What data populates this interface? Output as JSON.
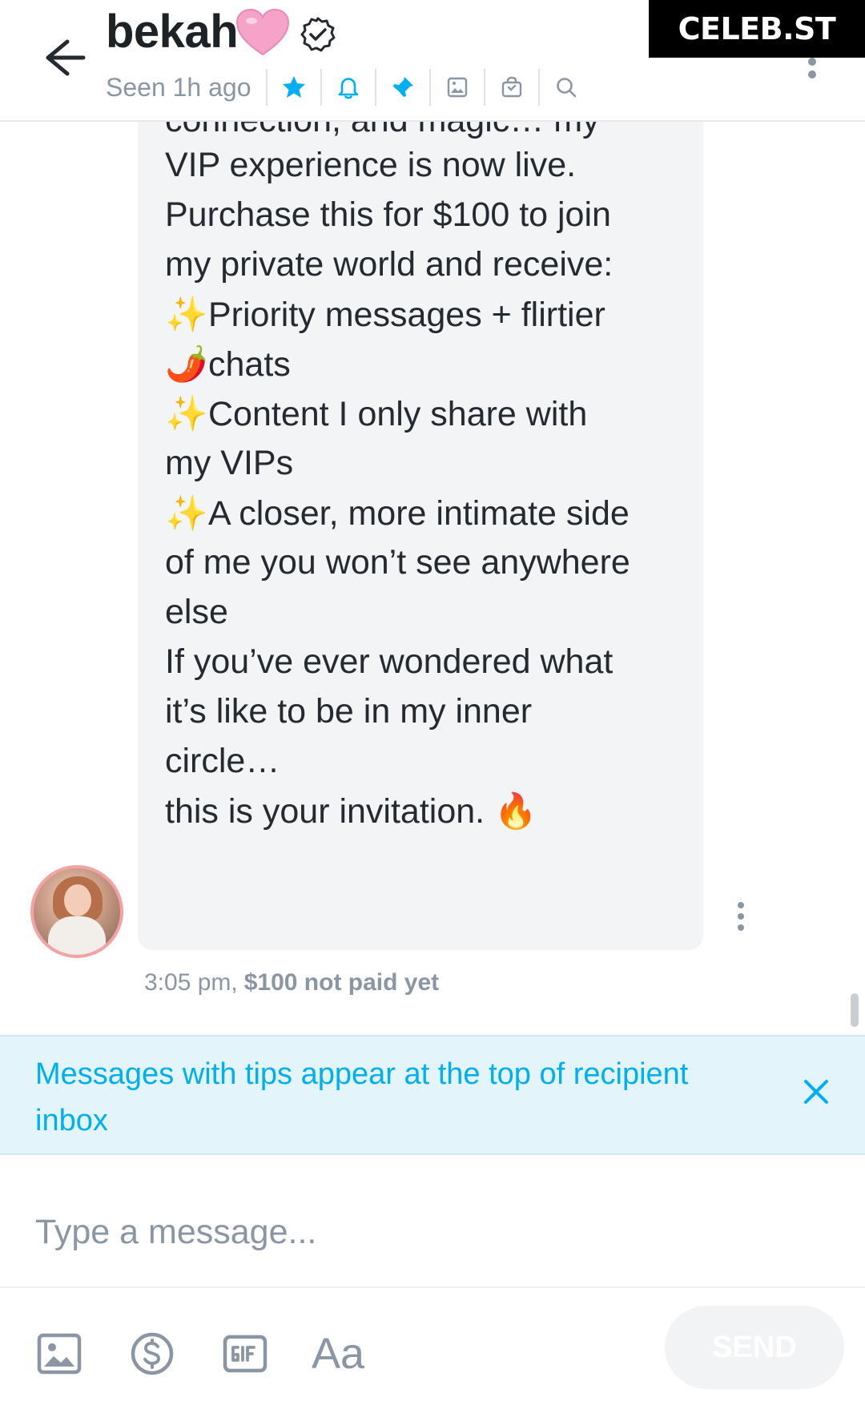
{
  "header": {
    "name": "bekah",
    "heart_emoji": "🩷",
    "seen": "Seen 1h ago"
  },
  "brand": "CELEB.ST",
  "message": {
    "lines": [
      "connection, and magic… my",
      "VIP experience is now live.",
      "Purchase this for $100 to join",
      "my private world and receive:",
      "Priority messages + flirtier",
      "chats",
      "Content I only share with",
      "my VIPs",
      "A closer, more intimate side",
      "of me you won’t see anywhere",
      "else",
      "If you’ve ever wondered what",
      "it’s like to be in my inner",
      "circle…",
      "this is your invitation."
    ],
    "sparkle_emoji": "✨",
    "pepper_emoji": "🌶️",
    "fire_emoji": "🔥",
    "time": "3:05 pm,",
    "price_status": "$100 not paid yet"
  },
  "tip_banner": {
    "text": "Messages with tips appear at the top of recipient inbox"
  },
  "composer": {
    "placeholder": "Type a message...",
    "text_tool": "Aa",
    "send_label": "SEND"
  },
  "icons": [
    "back-arrow-icon",
    "verified-icon",
    "star-icon",
    "bell-icon",
    "pin-icon",
    "image-icon",
    "bag-icon",
    "search-icon",
    "more-vertical-icon",
    "close-icon",
    "dollar-icon",
    "gif-icon"
  ],
  "colors": {
    "accent": "#00aff0",
    "muted": "#8a96a3",
    "bubble": "#f2f4f6",
    "tip_banner_bg": "#e4f4fb",
    "heart": "#f5a3c7"
  }
}
